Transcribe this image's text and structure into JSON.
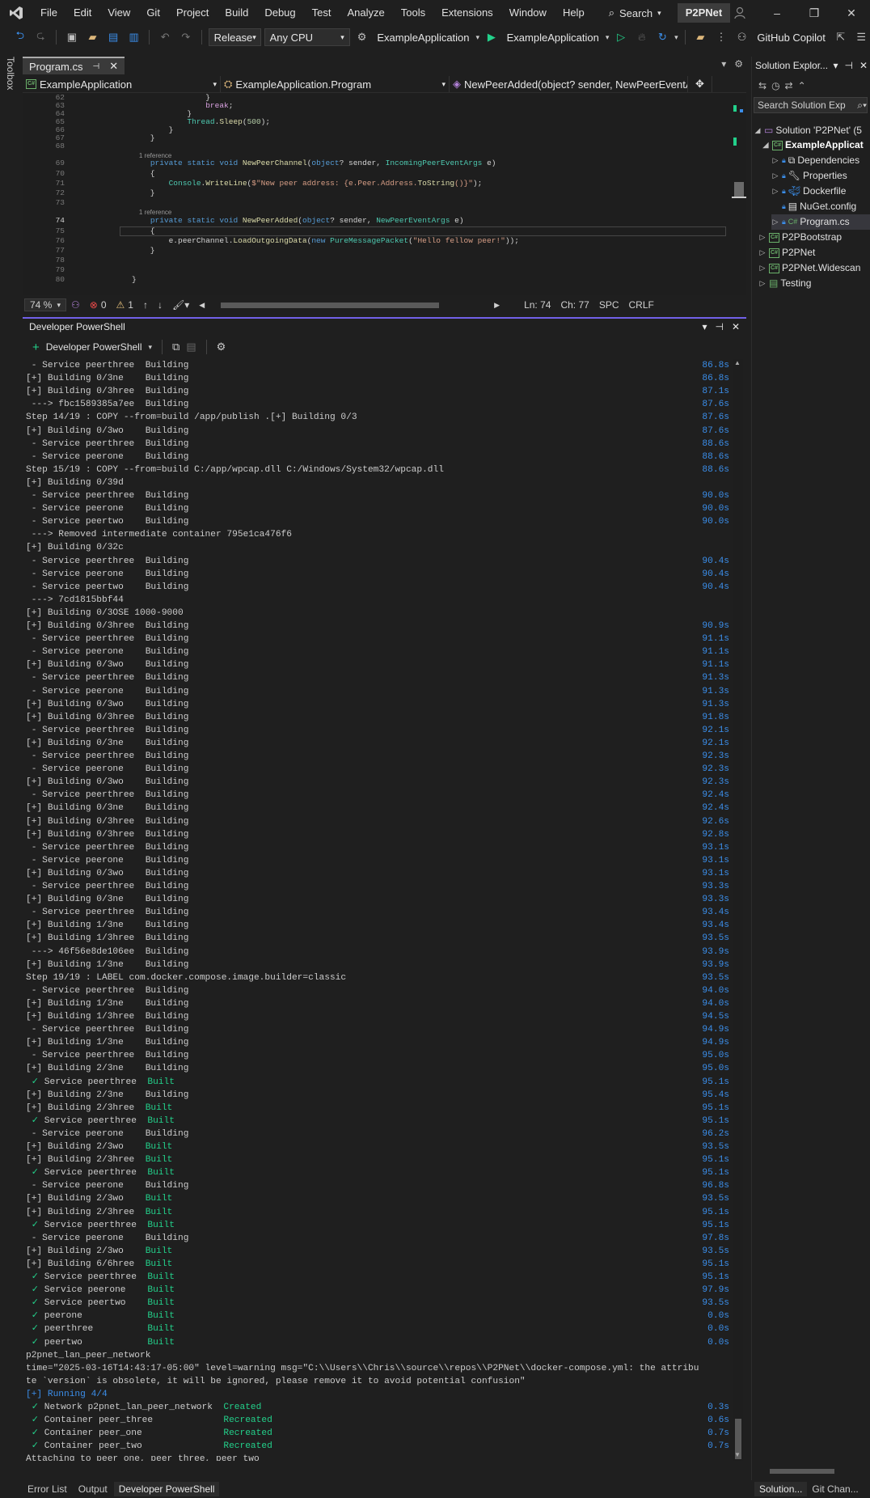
{
  "menubar": {
    "items": [
      "File",
      "Edit",
      "View",
      "Git",
      "Project",
      "Build",
      "Debug",
      "Test",
      "Analyze",
      "Tools",
      "Extensions",
      "Window",
      "Help"
    ],
    "search_label": "Search",
    "project_name": "P2PNet"
  },
  "toolbar": {
    "configuration": "Release",
    "platform": "Any CPU",
    "startup_project": "ExampleApplication",
    "run_target": "ExampleApplication",
    "copilot": "GitHub Copilot"
  },
  "toolbox_label": "Toolbox",
  "editor": {
    "tab_title": "Program.cs",
    "nav_project": "ExampleApplication",
    "nav_class": "ExampleApplication.Program",
    "nav_member": "NewPeerAdded(object? sender, NewPeerEventA",
    "status": {
      "zoom": "74 %",
      "errors": "0",
      "warnings": "1",
      "line": "Ln: 74",
      "col": "Ch: 77",
      "spacing": "SPC",
      "line_endings": "CRLF"
    },
    "lines": [
      {
        "n": "62",
        "t": "                }"
      },
      {
        "n": "63",
        "t": "                break;"
      },
      {
        "n": "64",
        "t": "            }"
      },
      {
        "n": "65",
        "t": "            Thread.Sleep(500);"
      },
      {
        "n": "66",
        "t": "        }"
      },
      {
        "n": "67",
        "t": "    }"
      },
      {
        "n": "68",
        "t": ""
      },
      {
        "n": "",
        "t": "    1 reference"
      },
      {
        "n": "69",
        "t": "    private static void NewPeerChannel(object? sender, IncomingPeerEventArgs e)"
      },
      {
        "n": "70",
        "t": "    {"
      },
      {
        "n": "71",
        "t": "        Console.WriteLine($\"New peer address: {e.Peer.Address.ToString()}\");"
      },
      {
        "n": "72",
        "t": "    }"
      },
      {
        "n": "73",
        "t": ""
      },
      {
        "n": "",
        "t": "    1 reference"
      },
      {
        "n": "74",
        "t": "    private static void NewPeerAdded(object? sender, NewPeerEventArgs e)"
      },
      {
        "n": "75",
        "t": "    {"
      },
      {
        "n": "76",
        "t": "        e.peerChannel.LoadOutgoingData(new PureMessagePacket(\"Hello fellow peer!\"));"
      },
      {
        "n": "77",
        "t": "    }"
      },
      {
        "n": "78",
        "t": ""
      },
      {
        "n": "79",
        "t": ""
      },
      {
        "n": "80",
        "t": "}"
      }
    ]
  },
  "terminal": {
    "title": "Developer PowerShell",
    "new_button": "Developer PowerShell",
    "lines": [
      {
        "t": " - Service peerthree  Building",
        "time": "86.8s"
      },
      {
        "t": "[+] Building 0/3ne    Building",
        "time": "86.8s"
      },
      {
        "t": "[+] Building 0/3hree  Building",
        "time": "87.1s"
      },
      {
        "t": " ---> fbc1589385a7ee  Building",
        "time": "87.6s"
      },
      {
        "t": "Step 14/19 : COPY --from=build /app/publish .[+] Building 0/3",
        "time": "87.6s"
      },
      {
        "t": "[+] Building 0/3wo    Building",
        "time": "87.6s"
      },
      {
        "t": " - Service peerthree  Building",
        "time": "88.6s"
      },
      {
        "t": " - Service peerone    Building",
        "time": "88.6s"
      },
      {
        "t": "Step 15/19 : COPY --from=build C:/app/wpcap.dll C:/Windows/System32/wpcap.dll",
        "time": "88.6s"
      },
      {
        "t": "[+] Building 0/39d",
        "time": ""
      },
      {
        "t": " - Service peerthree  Building",
        "time": "90.0s"
      },
      {
        "t": " - Service peerone    Building",
        "time": "90.0s"
      },
      {
        "t": " - Service peertwo    Building",
        "time": "90.0s"
      },
      {
        "t": " ---> Removed intermediate container 795e1ca476f6",
        "time": ""
      },
      {
        "t": "[+] Building 0/32c",
        "time": ""
      },
      {
        "t": " - Service peerthree  Building",
        "time": "90.4s"
      },
      {
        "t": " - Service peerone    Building",
        "time": "90.4s"
      },
      {
        "t": " - Service peertwo    Building",
        "time": "90.4s"
      },
      {
        "t": " ---> 7cd1815bbf44",
        "time": ""
      },
      {
        "t": "[+] Building 0/3OSE 1000-9000",
        "time": ""
      },
      {
        "t": "[+] Building 0/3hree  Building",
        "time": "90.9s"
      },
      {
        "t": " - Service peerthree  Building",
        "time": "91.1s"
      },
      {
        "t": " - Service peerone    Building",
        "time": "91.1s"
      },
      {
        "t": "[+] Building 0/3wo    Building",
        "time": "91.1s"
      },
      {
        "t": " - Service peerthree  Building",
        "time": "91.3s"
      },
      {
        "t": " - Service peerone    Building",
        "time": "91.3s"
      },
      {
        "t": "[+] Building 0/3wo    Building",
        "time": "91.3s"
      },
      {
        "t": "[+] Building 0/3hree  Building",
        "time": "91.8s"
      },
      {
        "t": " - Service peerthree  Building",
        "time": "92.1s"
      },
      {
        "t": "[+] Building 0/3ne    Building",
        "time": "92.1s"
      },
      {
        "t": " - Service peerthree  Building",
        "time": "92.3s"
      },
      {
        "t": " - Service peerone    Building",
        "time": "92.3s"
      },
      {
        "t": "[+] Building 0/3wo    Building",
        "time": "92.3s"
      },
      {
        "t": " - Service peerthree  Building",
        "time": "92.4s"
      },
      {
        "t": "[+] Building 0/3ne    Building",
        "time": "92.4s"
      },
      {
        "t": "[+] Building 0/3hree  Building",
        "time": "92.6s"
      },
      {
        "t": "[+] Building 0/3hree  Building",
        "time": "92.8s"
      },
      {
        "t": " - Service peerthree  Building",
        "time": "93.1s"
      },
      {
        "t": " - Service peerone    Building",
        "time": "93.1s"
      },
      {
        "t": "[+] Building 0/3wo    Building",
        "time": "93.1s"
      },
      {
        "t": " - Service peerthree  Building",
        "time": "93.3s"
      },
      {
        "t": "[+] Building 0/3ne    Building",
        "time": "93.3s"
      },
      {
        "t": " - Service peerthree  Building",
        "time": "93.4s"
      },
      {
        "t": "[+] Building 1/3ne    Building",
        "time": "93.4s"
      },
      {
        "t": "[+] Building 1/3hree  Building",
        "time": "93.5s"
      },
      {
        "t": " ---> 46f56e8de106ee  Building",
        "time": "93.9s"
      },
      {
        "t": "[+] Building 1/3ne    Building",
        "time": "93.9s"
      },
      {
        "t": "Step 19/19 : LABEL com.docker.compose.image.builder=classic",
        "time": "93.5s"
      },
      {
        "t": " - Service peerthree  Building",
        "time": "94.0s"
      },
      {
        "t": "[+] Building 1/3ne    Building",
        "time": "94.0s"
      },
      {
        "t": "[+] Building 1/3hree  Building",
        "time": "94.5s"
      },
      {
        "t": " - Service peerthree  Building",
        "time": "94.9s"
      },
      {
        "t": "[+] Building 1/3ne    Building",
        "time": "94.9s"
      },
      {
        "t": " - Service peerthree  Building",
        "time": "95.0s"
      },
      {
        "t": "[+] Building 2/3ne    Building",
        "time": "95.0s"
      },
      {
        "t": " ✓ Service peerthree  Built",
        "time": "95.1s",
        "style": "built"
      },
      {
        "t": "[+] Building 2/3ne    Building",
        "time": "95.4s"
      },
      {
        "t": "[+] Building 2/3hree  Built",
        "time": "95.1s",
        "style": "built"
      },
      {
        "t": " ✓ Service peerthree  Built",
        "time": "95.1s",
        "style": "built"
      },
      {
        "t": " - Service peerone    Building",
        "time": "96.2s"
      },
      {
        "t": "[+] Building 2/3wo    Built",
        "time": "93.5s",
        "style": "built"
      },
      {
        "t": "[+] Building 2/3hree  Built",
        "time": "95.1s",
        "style": "built"
      },
      {
        "t": " ✓ Service peerthree  Built",
        "time": "95.1s",
        "style": "built"
      },
      {
        "t": " - Service peerone    Building",
        "time": "96.8s"
      },
      {
        "t": "[+] Building 2/3wo    Built",
        "time": "93.5s",
        "style": "built"
      },
      {
        "t": "[+] Building 2/3hree  Built",
        "time": "95.1s",
        "style": "built"
      },
      {
        "t": " ✓ Service peerthree  Built",
        "time": "95.1s",
        "style": "built"
      },
      {
        "t": " - Service peerone    Building",
        "time": "97.8s"
      },
      {
        "t": "[+] Building 2/3wo    Built",
        "time": "93.5s",
        "style": "built"
      },
      {
        "t": "[+] Building 6/6hree  Built",
        "time": "95.1s",
        "style": "built"
      },
      {
        "t": " ✓ Service peerthree  Built",
        "time": "95.1s",
        "style": "built"
      },
      {
        "t": " ✓ Service peerone    Built",
        "time": "97.9s",
        "style": "built"
      },
      {
        "t": " ✓ Service peertwo    Built",
        "time": "93.5s",
        "style": "built"
      },
      {
        "t": " ✓ peerone            Built",
        "time": "0.0s",
        "style": "built"
      },
      {
        "t": " ✓ peerthree          Built",
        "time": "0.0s",
        "style": "built"
      },
      {
        "t": " ✓ peertwo            Built",
        "time": "0.0s",
        "style": "built"
      },
      {
        "t": "p2pnet_lan_peer_network",
        "time": ""
      },
      {
        "t": "time=\"2025-03-16T14:43:17-05:00\" level=warning msg=\"C:\\\\Users\\\\Chris\\\\source\\\\repos\\\\P2PNet\\\\docker-compose.yml: the attribu",
        "time": ""
      },
      {
        "t": "te `version` is obsolete, it will be ignored, please remove it to avoid potential confusion\"",
        "time": ""
      },
      {
        "t": "[+] Running 4/4",
        "time": "",
        "style": "blue"
      },
      {
        "t": " ✓ Network p2pnet_lan_peer_network  Created",
        "time": "0.3s",
        "style": "created"
      },
      {
        "t": " ✓ Container peer_three             Recreated",
        "time": "0.6s",
        "style": "created"
      },
      {
        "t": " ✓ Container peer_one               Recreated",
        "time": "0.7s",
        "style": "created"
      },
      {
        "t": " ✓ Container peer_two               Recreated",
        "time": "0.7s",
        "style": "created"
      },
      {
        "t": "Attaching to peer_one, peer_three, peer_two",
        "time": ""
      }
    ]
  },
  "bottom_tabs": [
    "Error List",
    "Output",
    "Developer PowerShell"
  ],
  "solution": {
    "title": "Solution Explor...",
    "search_placeholder": "Search Solution Exp",
    "items": [
      {
        "label": "Solution 'P2PNet' (5",
        "level": 0
      },
      {
        "label": "ExampleApplicat",
        "level": 1
      },
      {
        "label": "Dependencies",
        "level": 2
      },
      {
        "label": "Properties",
        "level": 2
      },
      {
        "label": "Dockerfile",
        "level": 2
      },
      {
        "label": "NuGet.config",
        "level": 2
      },
      {
        "label": "Program.cs",
        "level": 2
      },
      {
        "label": "P2PBootstrap",
        "level": 1
      },
      {
        "label": "P2PNet",
        "level": 1
      },
      {
        "label": "P2PNet.Widescan",
        "level": 1
      },
      {
        "label": "Testing",
        "level": 1
      }
    ],
    "bottom_tabs": [
      "Solution...",
      "Git Chan..."
    ]
  },
  "colors": {
    "accent": "#7160e8",
    "built": "#23d18b",
    "time": "#3b8eea"
  }
}
